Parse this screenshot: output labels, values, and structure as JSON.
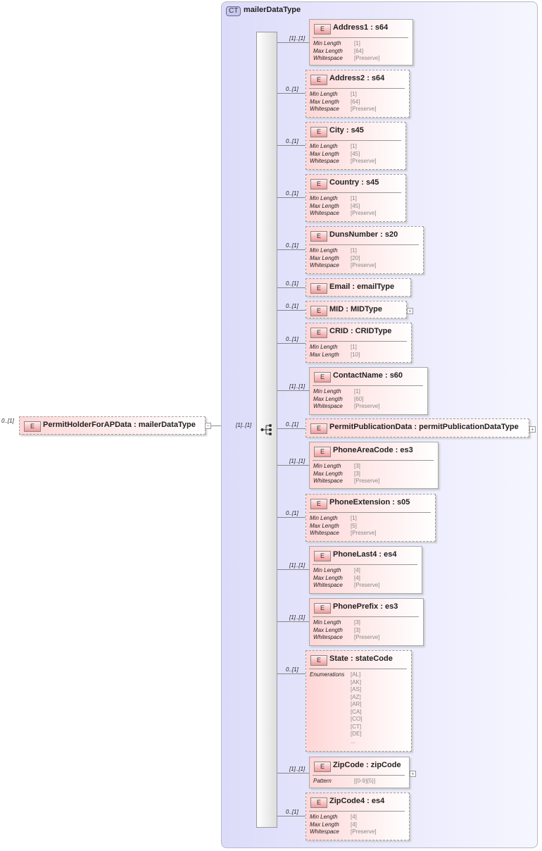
{
  "root": {
    "occurs": "0..[1]",
    "name": "PermitHolderForAPData",
    "type": "mailerDataType",
    "badge": "E",
    "collapse": "−"
  },
  "complex_type": {
    "badge": "CT",
    "name": "mailerDataType",
    "sequence_occurs": "[1]..[1]"
  },
  "elements": [
    {
      "name": "Address1",
      "type": "s64",
      "occurs": "[1]..[1]",
      "optional": false,
      "props": [
        [
          "Min Length",
          "[1]"
        ],
        [
          "Max Length",
          "[64]"
        ],
        [
          "Whitespace",
          "[Preserve]"
        ]
      ]
    },
    {
      "name": "Address2",
      "type": "s64",
      "occurs": "0..[1]",
      "optional": true,
      "props": [
        [
          "Min Length",
          "[1]"
        ],
        [
          "Max Length",
          "[64]"
        ],
        [
          "Whitespace",
          "[Preserve]"
        ]
      ]
    },
    {
      "name": "City",
      "type": "s45",
      "occurs": "0..[1]",
      "optional": true,
      "props": [
        [
          "Min Length",
          "[1]"
        ],
        [
          "Max Length",
          "[45]"
        ],
        [
          "Whitespace",
          "[Preserve]"
        ]
      ]
    },
    {
      "name": "Country",
      "type": "s45",
      "occurs": "0..[1]",
      "optional": true,
      "props": [
        [
          "Min Length",
          "[1]"
        ],
        [
          "Max Length",
          "[45]"
        ],
        [
          "Whitespace",
          "[Preserve]"
        ]
      ]
    },
    {
      "name": "DunsNumber",
      "type": "s20",
      "occurs": "0..[1]",
      "optional": true,
      "props": [
        [
          "Min Length",
          "[1]"
        ],
        [
          "Max Length",
          "[20]"
        ],
        [
          "Whitespace",
          "[Preserve]"
        ]
      ]
    },
    {
      "name": "Email",
      "type": "emailType",
      "occurs": "0..[1]",
      "optional": true,
      "props": []
    },
    {
      "name": "MID",
      "type": "MIDType",
      "occurs": "0..[1]",
      "optional": true,
      "props": [],
      "expand": "+"
    },
    {
      "name": "CRID",
      "type": "CRIDType",
      "occurs": "0..[1]",
      "optional": true,
      "props": [
        [
          "Min Length",
          "[1]"
        ],
        [
          "Max Length",
          "[10]"
        ]
      ]
    },
    {
      "name": "ContactName",
      "type": "s60",
      "occurs": "[1]..[1]",
      "optional": false,
      "props": [
        [
          "Min Length",
          "[1]"
        ],
        [
          "Max Length",
          "[60]"
        ],
        [
          "Whitespace",
          "[Preserve]"
        ]
      ]
    },
    {
      "name": "PermitPublicationData",
      "type": "permitPublicationDataType",
      "occurs": "0..[1]",
      "optional": true,
      "props": [],
      "expand": "+"
    },
    {
      "name": "PhoneAreaCode",
      "type": "es3",
      "occurs": "[1]..[1]",
      "optional": false,
      "props": [
        [
          "Min Length",
          "[3]"
        ],
        [
          "Max Length",
          "[3]"
        ],
        [
          "Whitespace",
          "[Preserve]"
        ]
      ]
    },
    {
      "name": "PhoneExtension",
      "type": "s05",
      "occurs": "0..[1]",
      "optional": true,
      "props": [
        [
          "Min Length",
          "[1]"
        ],
        [
          "Max Length",
          "[5]"
        ],
        [
          "Whitespace",
          "[Preserve]"
        ]
      ]
    },
    {
      "name": "PhoneLast4",
      "type": "es4",
      "occurs": "[1]..[1]",
      "optional": false,
      "props": [
        [
          "Min Length",
          "[4]"
        ],
        [
          "Max Length",
          "[4]"
        ],
        [
          "Whitespace",
          "[Preserve]"
        ]
      ]
    },
    {
      "name": "PhonePrefix",
      "type": "es3",
      "occurs": "[1]..[1]",
      "optional": false,
      "props": [
        [
          "Min Length",
          "[3]"
        ],
        [
          "Max Length",
          "[3]"
        ],
        [
          "Whitespace",
          "[Preserve]"
        ]
      ]
    },
    {
      "name": "State",
      "type": "stateCode",
      "occurs": "0..[1]",
      "optional": true,
      "props": [
        [
          "Enumerations",
          "[AL]\n[AK]\n[AS]\n[AZ]\n[AR]\n[CA]\n[CO]\n[CT]\n[DE]\n..."
        ]
      ]
    },
    {
      "name": "ZipCode",
      "type": "zipCode",
      "occurs": "[1]..[1]",
      "optional": false,
      "props": [
        [
          "Pattern",
          "[[0-9]{5}]"
        ]
      ],
      "expand": "+"
    },
    {
      "name": "ZipCode4",
      "type": "es4",
      "occurs": "0..[1]",
      "optional": true,
      "props": [
        [
          "Min Length",
          "[4]"
        ],
        [
          "Max Length",
          "[4]"
        ],
        [
          "Whitespace",
          "[Preserve]"
        ]
      ]
    }
  ]
}
